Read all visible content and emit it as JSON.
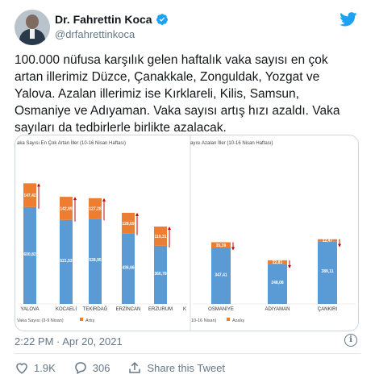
{
  "author": {
    "name": "Dr. Fahrettin Koca",
    "handle": "@drfahrettinkoca"
  },
  "tweet": {
    "text": "100.000 nüfusa karşılık gelen haftalık vaka sayısı en çok artan illerimiz Düzce, Çanakkale, Zonguldak, Yozgat ve Yalova. Azalan illerimiz ise Kırklareli, Kilis, Samsun, Osmaniye ve Adıyaman. Vaka sayısı artış hızı azaldı. Vaka sayıları da tedbirlerle birlikte azalacak.",
    "timestamp": "2:22 PM · Apr 20, 2021"
  },
  "actions": {
    "like_count": "1.9K",
    "reply_count": "306",
    "share_label": "Share this Tweet"
  },
  "colors": {
    "base_bar": "#5b9bd5",
    "delta_bar": "#ed7d31",
    "arrow": "#c00000",
    "twitter_blue": "#1da1f2"
  },
  "chart_data": [
    {
      "type": "bar",
      "title": "aka Sayısı En Çok Artan İller (10-16 Nisan Haftası)",
      "categories": [
        "YALOVA",
        "KOCAELİ",
        "TEKİRDAĞ",
        "ERZİNCAN",
        "ERZURUM",
        "K"
      ],
      "series": [
        {
          "name": "Vaka Sayısı (3-9 Nisan)",
          "values": [
            600.82,
            521.53,
            528.95,
            436.66,
            360.78,
            null
          ]
        },
        {
          "name": "Artış",
          "values": [
            147.42,
            142.89,
            127.28,
            128.69,
            119.31,
            null
          ]
        }
      ],
      "base_labels": [
        "600,82",
        "521,53",
        "528,95",
        "436,66",
        "360,78",
        ""
      ],
      "delta_labels": [
        "147,42",
        "142,89",
        "127,28",
        "128,69",
        "119,31",
        ""
      ],
      "legend": [
        "Vaka Sayısı (3-9 Nisan)",
        "Artış"
      ],
      "ylim": [
        0,
        800
      ]
    },
    {
      "type": "bar",
      "title": "ayısı Azalan İller (10-16 Nisan Haftası)",
      "categories": [
        "OSMANİYE",
        "ADIYAMAN",
        "ÇANKIRI"
      ],
      "series": [
        {
          "name": "(10-16 Nisan)",
          "values": [
            347.41,
            248.08,
            389.11
          ]
        },
        {
          "name": "Azalış",
          "values": [
            35.39,
            22.81,
            12.47
          ]
        }
      ],
      "base_labels": [
        "347,41",
        "248,08",
        "389,11"
      ],
      "delta_labels": [
        "35,39",
        "22,81",
        "12,47"
      ],
      "legend": [
        "10-16 Nisan)",
        "Azalış"
      ],
      "ylim": [
        0,
        800
      ]
    }
  ]
}
